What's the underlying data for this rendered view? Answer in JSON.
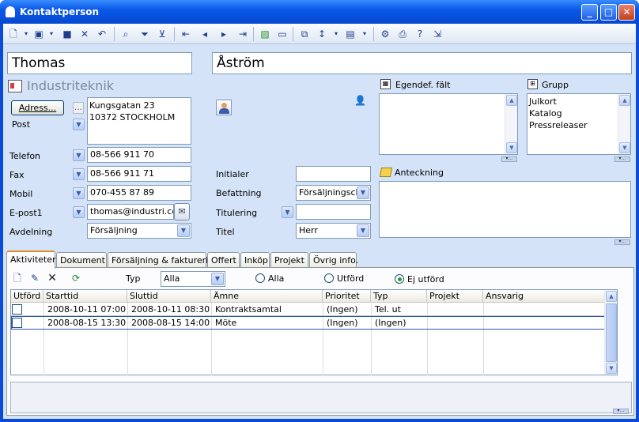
{
  "window": {
    "title": "Kontaktperson",
    "buttons": {
      "minimize": "_",
      "maximize": "□",
      "close": "✕"
    }
  },
  "toolbar": {
    "items": [
      "new-icon",
      "folder-icon",
      "save-icon",
      "delete-icon",
      "undo-icon",
      "search-icon",
      "filter-icon",
      "filter-clear-icon",
      "first-icon",
      "prev-icon",
      "next-icon",
      "last-icon",
      "image-icon",
      "screen-icon",
      "copy-icon",
      "sort-icon",
      "page-icon",
      "settings-icon",
      "print-icon",
      "help-icon",
      "exit-icon"
    ]
  },
  "contact": {
    "first_name": "Thomas",
    "last_name": "Åström",
    "company": "Industriteknik"
  },
  "address": {
    "button": "Adress...",
    "dots": "...",
    "lines": [
      "Kungsgatan 23",
      "10372 STOCKHOLM"
    ],
    "type_label": "Post"
  },
  "fields": {
    "telefon": {
      "label": "Telefon",
      "value": "08-566 911 70"
    },
    "fax": {
      "label": "Fax",
      "value": "08-566 911 71"
    },
    "mobil": {
      "label": "Mobil",
      "value": "070-455 87 89"
    },
    "epost": {
      "label": "E-post1",
      "value": "thomas@industri.com"
    },
    "avdelning": {
      "label": "Avdelning",
      "value": "Försäljning"
    },
    "initialer": {
      "label": "Initialer",
      "value": ""
    },
    "befattning": {
      "label": "Befattning",
      "value": "Försäljningschef"
    },
    "titulering": {
      "label": "Titulering",
      "value": ""
    },
    "titel": {
      "label": "Titel",
      "value": "Herr"
    }
  },
  "egendef": {
    "label": "Egendef. fält"
  },
  "grupp": {
    "label": "Grupp",
    "items": [
      "Julkort",
      "Katalog",
      "Pressreleaser"
    ]
  },
  "anteckning": {
    "label": "Anteckning"
  },
  "tabs": [
    "Aktiviteter",
    "Dokument",
    "Försäljning & fakturering",
    "Offert",
    "Inköp",
    "Projekt",
    "Övrig info."
  ],
  "activities": {
    "typ_label": "Typ",
    "typ_value": "Alla",
    "radio": {
      "alla": "Alla",
      "utford": "Utförd",
      "ej_utford": "Ej utförd"
    },
    "columns": [
      "Utförd",
      "Starttid",
      "Sluttid",
      "Ämne",
      "Prioritet",
      "Typ",
      "Projekt",
      "Ansvarig"
    ],
    "rows": [
      {
        "start": "2008-10-11 07:00",
        "slut": "2008-10-11 08:30",
        "amne": "Kontraktsamtal",
        "prio": "(Ingen)",
        "typ": "Tel. ut",
        "projekt": "",
        "ansvarig": ""
      },
      {
        "start": "2008-08-15 13:30",
        "slut": "2008-08-15 14:00",
        "amne": "Möte",
        "prio": "(Ingen)",
        "typ": "(Ingen)",
        "projekt": "",
        "ansvarig": ""
      }
    ]
  }
}
